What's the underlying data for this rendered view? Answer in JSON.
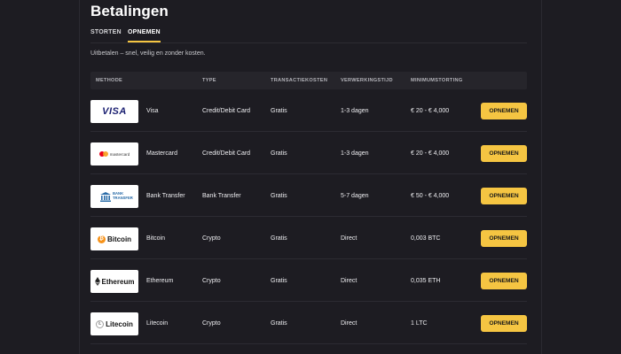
{
  "page": {
    "title": "Betalingen",
    "subtitle": "Uitbetalen – snel, veilig en zonder kosten."
  },
  "tabs": [
    {
      "label": "STORTEN",
      "active": false
    },
    {
      "label": "OPNEMEN",
      "active": true
    }
  ],
  "table": {
    "headers": {
      "method": "METHODE",
      "type": "TYPE",
      "fee": "TRANSACTIEKOSTEN",
      "time": "VERWERKINGSTIJD",
      "min": "MINIMUMSTORTING"
    },
    "rows": [
      {
        "name": "Visa",
        "type": "Credit/Debit Card",
        "fee": "Gratis",
        "time": "1-3 dagen",
        "min": "€ 20 - € 4,000",
        "button": "OPNEMEN",
        "logo_text": "VISA",
        "logo": "visa-logo"
      },
      {
        "name": "Mastercard",
        "type": "Credit/Debit Card",
        "fee": "Gratis",
        "time": "1-3 dagen",
        "min": "€ 20 - € 4,000",
        "button": "OPNEMEN",
        "logo_text": "mastercard",
        "logo": "mastercard-logo"
      },
      {
        "name": "Bank Transfer",
        "type": "Bank Transfer",
        "fee": "Gratis",
        "time": "5-7 dagen",
        "min": "€ 50 - € 4,000",
        "button": "OPNEMEN",
        "logo_text": "BANK TRANSFER",
        "logo": "bank-logo"
      },
      {
        "name": "Bitcoin",
        "type": "Crypto",
        "fee": "Gratis",
        "time": "Direct",
        "min": "0,003 BTC",
        "button": "OPNEMEN",
        "logo_text": "Bitcoin",
        "logo": "bitcoin-logo"
      },
      {
        "name": "Ethereum",
        "type": "Crypto",
        "fee": "Gratis",
        "time": "Direct",
        "min": "0,035 ETH",
        "button": "OPNEMEN",
        "logo_text": "Ethereum",
        "logo": "ethereum-logo"
      },
      {
        "name": "Litecoin",
        "type": "Crypto",
        "fee": "Gratis",
        "time": "Direct",
        "min": "1 LTC",
        "button": "OPNEMEN",
        "logo_text": "Litecoin",
        "logo": "litecoin-logo"
      }
    ]
  },
  "colors": {
    "background": "#1d1c22",
    "accent": "#f5c542",
    "header_bg": "#26252b",
    "bitcoin": "#f7931a"
  }
}
